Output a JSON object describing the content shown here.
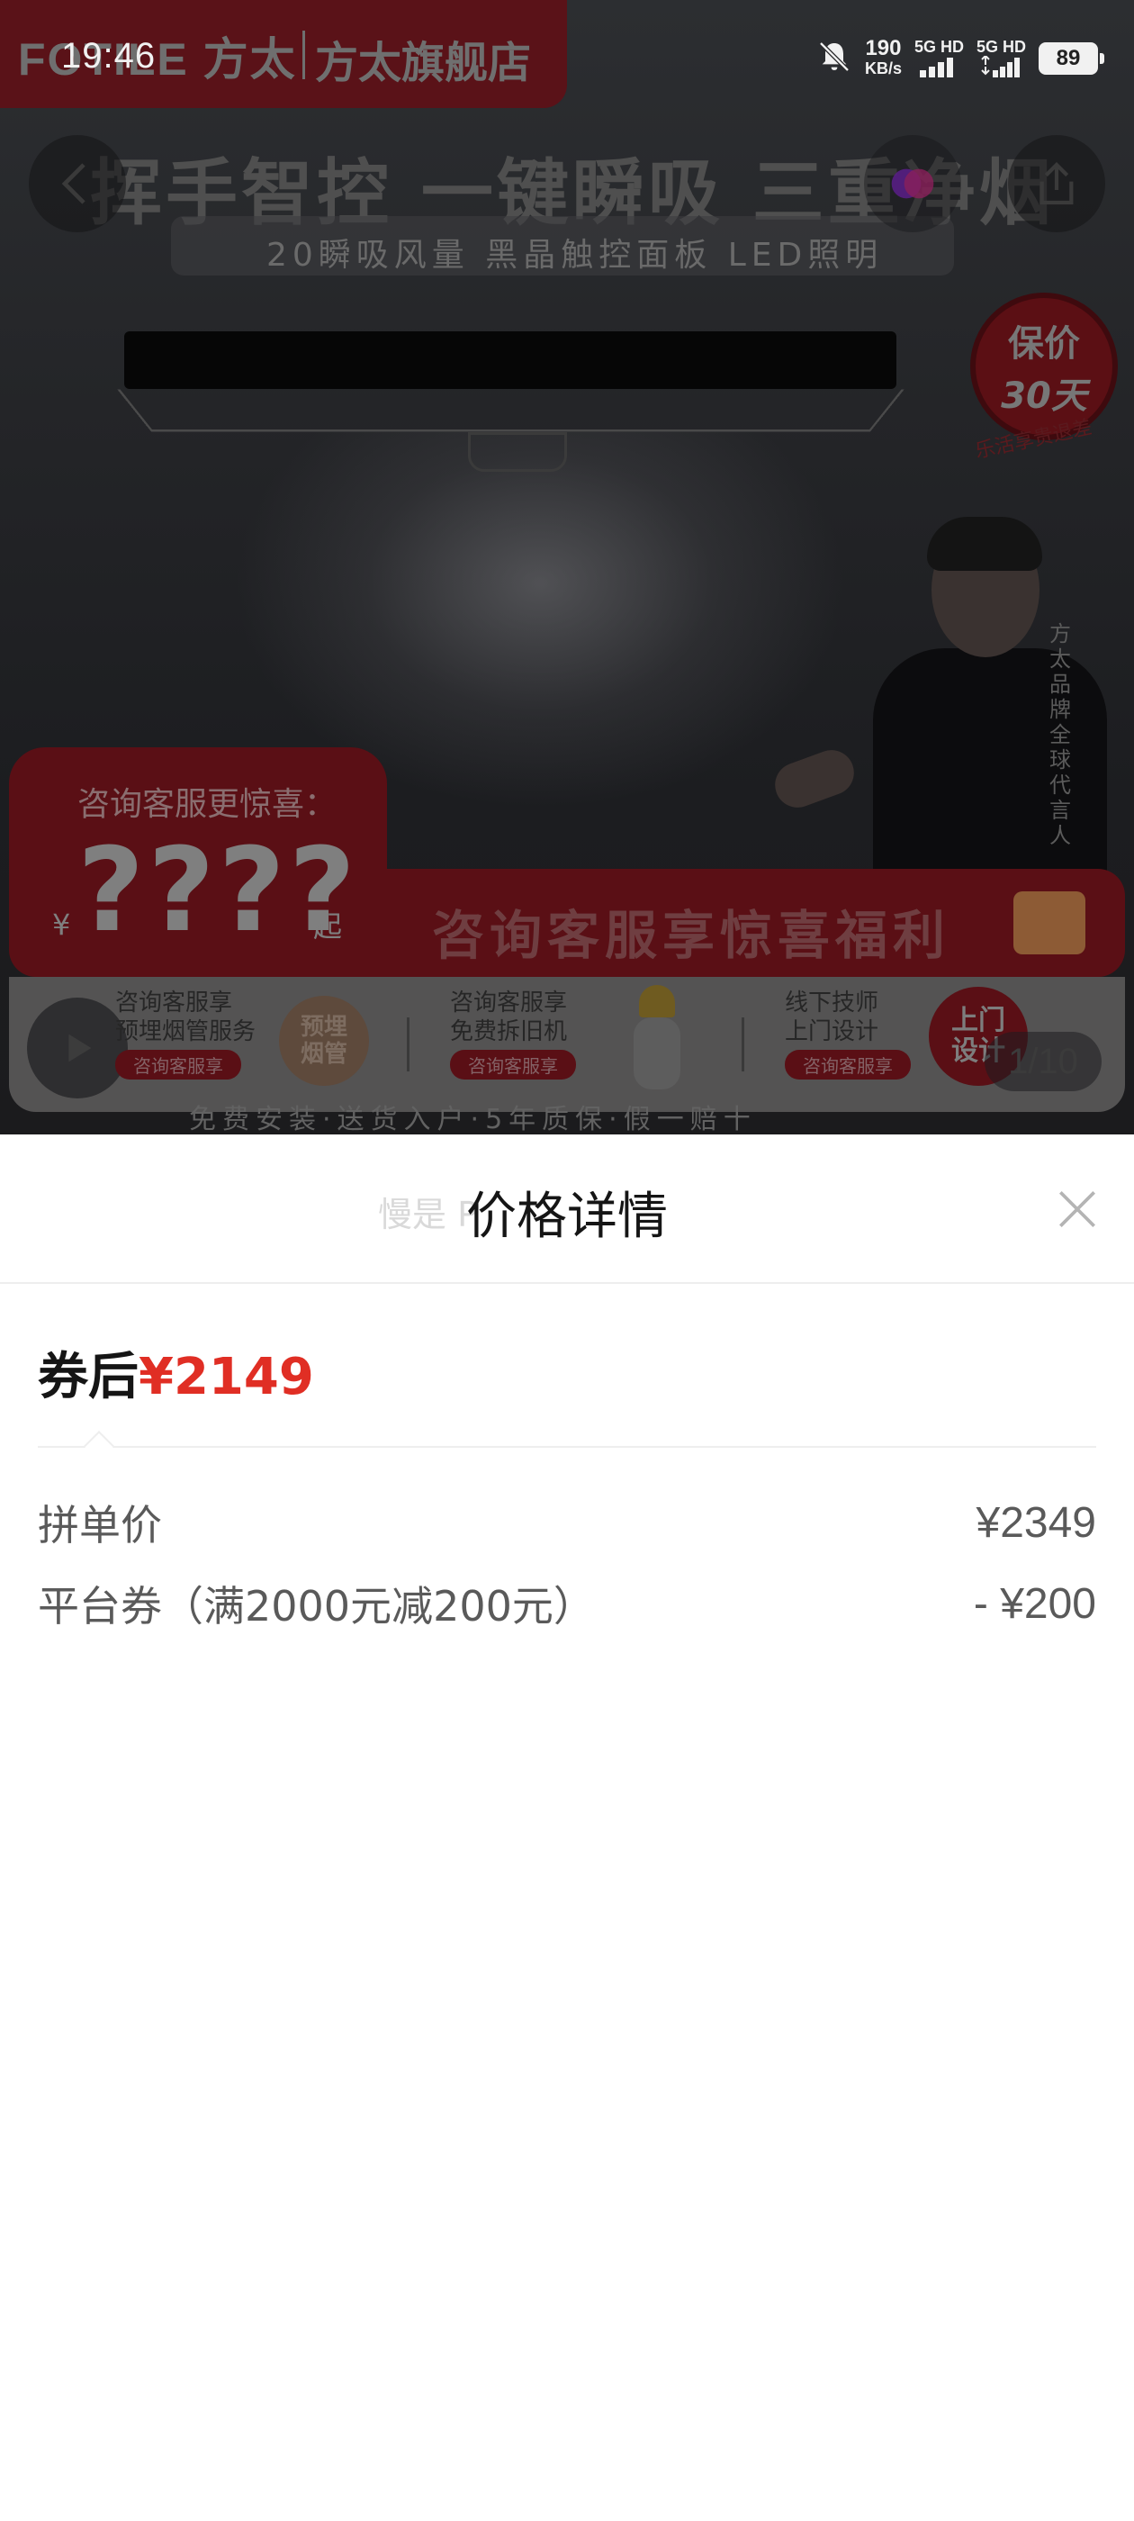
{
  "status_bar": {
    "time": "19:46",
    "net_speed_value": "190",
    "net_speed_unit": "KB/s",
    "signal1_label": "5G HD",
    "signal2_label": "5G HD",
    "battery": "89"
  },
  "product": {
    "brand_logo": "FOTILE 方太",
    "store_name": "方太旗舰店",
    "headline": "挥手智控 一键瞬吸 三重净烟",
    "subline": "20瞬吸风量 黑晶触控面板 LED照明",
    "guarantee_line1": "保价",
    "guarantee_line2": "30天",
    "guarantee_note": "乐活享贵退差",
    "endorsement": "方太品牌全球代言人",
    "promo_ask": "咨询客服更惊喜：",
    "promo_price": "????",
    "promo_yen": "¥",
    "promo_qi": "起",
    "promo_banner": "咨询客服享惊喜福利",
    "service1": "咨询客服享\n预埋烟管服务",
    "service1_tag": "咨询客服享",
    "service1_seal": "预埋\n烟管",
    "service2": "咨询客服享\n免费拆旧机",
    "service2_tag": "咨询客服享",
    "service3": "线下技师\n上门设计",
    "service3_tag": "咨询客服享",
    "service3_seal": "上门\n设计",
    "page_indicator": "1/10",
    "footer": "免费安装·送货入户·5年质保·假一赔十"
  },
  "sheet": {
    "ghost_text": "慢是 P",
    "title": "价格详情",
    "total_label": "券后",
    "total_value": "¥2149",
    "rows": [
      {
        "label": "拼单价",
        "value": "¥2349"
      },
      {
        "label": "平台券（满2000元减200元）",
        "value": "- ¥200"
      }
    ]
  },
  "colors": {
    "accent_red": "#e02e24",
    "text_primary": "#151515",
    "text_secondary": "#5a5a5a"
  },
  "icons": [
    "back-arrow-icon",
    "favorite-icon",
    "share-icon",
    "play-icon",
    "close-icon",
    "bell-off-icon",
    "signal-icon",
    "battery-icon"
  ]
}
